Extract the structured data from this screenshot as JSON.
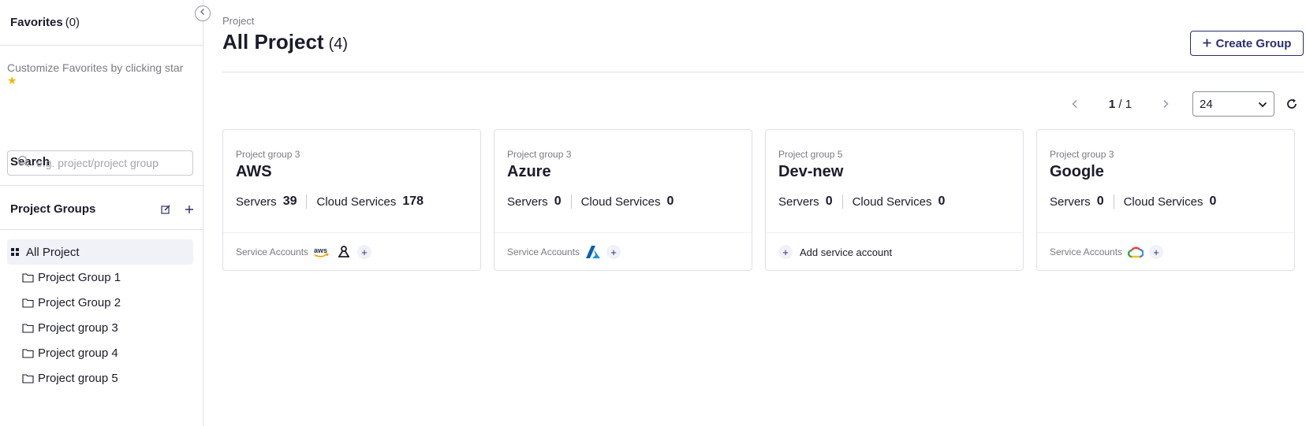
{
  "sidebar": {
    "favorites_title": "Favorites",
    "favorites_count": "(0)",
    "favorites_help": "Customize Favorites by clicking star",
    "search_title": "Search",
    "search_placeholder": "e.g. project/project group",
    "groups_title": "Project Groups",
    "tree": [
      {
        "label": "All Project",
        "icon": "grid-icon"
      },
      {
        "label": "Project Group 1",
        "icon": "folder-icon"
      },
      {
        "label": "Project Group 2",
        "icon": "folder-icon"
      },
      {
        "label": "Project group 3",
        "icon": "folder-icon"
      },
      {
        "label": "Project group 4",
        "icon": "folder-icon"
      },
      {
        "label": "Project group 5",
        "icon": "folder-icon"
      }
    ]
  },
  "main": {
    "breadcrumb": "Project",
    "title": "All Project",
    "count": "(4)",
    "create_label": "Create Group",
    "pager": {
      "current": "1",
      "sep": " / ",
      "total": "1",
      "page_size": "24"
    },
    "cards": [
      {
        "group": "Project group 3",
        "name": "AWS",
        "servers_label": "Servers",
        "servers": "39",
        "cloud_label": "Cloud Services",
        "cloud": "178",
        "sa_label": "Service Accounts",
        "accounts": [
          "aws-icon",
          "tencent-icon"
        ]
      },
      {
        "group": "Project group 3",
        "name": "Azure",
        "servers_label": "Servers",
        "servers": "0",
        "cloud_label": "Cloud Services",
        "cloud": "0",
        "sa_label": "Service Accounts",
        "accounts": [
          "azure-icon"
        ]
      },
      {
        "group": "Project group 5",
        "name": "Dev-new",
        "servers_label": "Servers",
        "servers": "0",
        "cloud_label": "Cloud Services",
        "cloud": "0",
        "add_sa_label": "Add service account"
      },
      {
        "group": "Project group 3",
        "name": "Google",
        "servers_label": "Servers",
        "servers": "0",
        "cloud_label": "Cloud Services",
        "cloud": "0",
        "sa_label": "Service Accounts",
        "accounts": [
          "google-cloud-icon"
        ]
      }
    ]
  },
  "colors": {
    "accent": "#2b2e6e",
    "border": "#dfe0e6",
    "muted": "#7a7b85",
    "selected_bg": "#f0f2f8",
    "star": "#f5b700"
  }
}
